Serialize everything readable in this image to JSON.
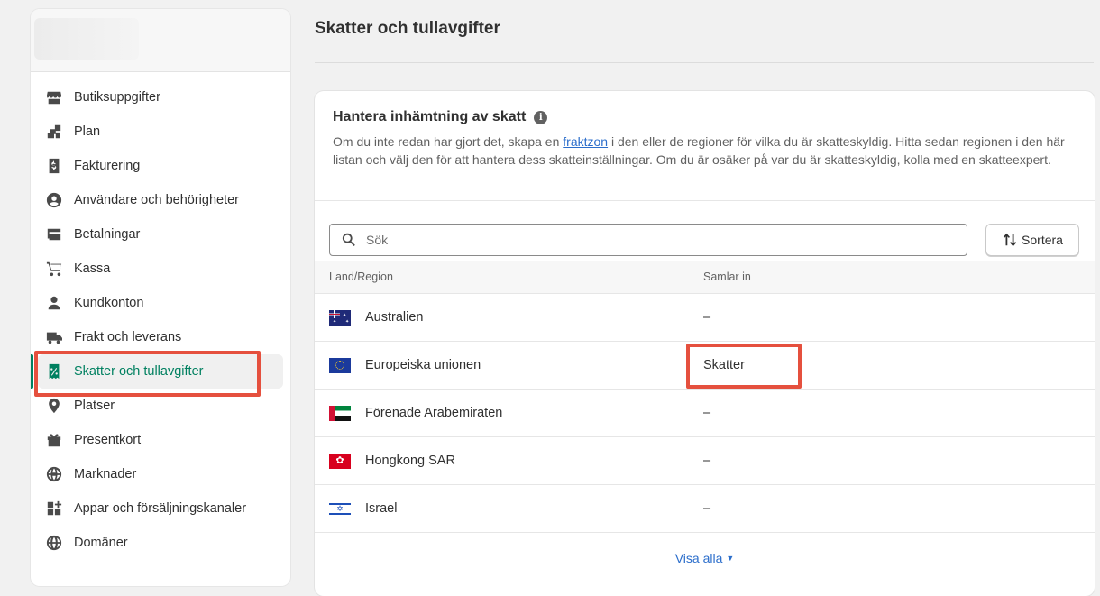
{
  "sidebar": {
    "items": [
      {
        "label": "Butiksuppgifter",
        "icon": "store-icon"
      },
      {
        "label": "Plan",
        "icon": "plan-icon"
      },
      {
        "label": "Fakturering",
        "icon": "billing-icon"
      },
      {
        "label": "Användare och behörigheter",
        "icon": "user-circle-icon"
      },
      {
        "label": "Betalningar",
        "icon": "payments-icon"
      },
      {
        "label": "Kassa",
        "icon": "cart-icon"
      },
      {
        "label": "Kundkonton",
        "icon": "person-icon"
      },
      {
        "label": "Frakt och leverans",
        "icon": "truck-icon"
      },
      {
        "label": "Skatter och tullavgifter",
        "icon": "tax-receipt-icon",
        "active": true
      },
      {
        "label": "Platser",
        "icon": "location-pin-icon"
      },
      {
        "label": "Presentkort",
        "icon": "gift-icon"
      },
      {
        "label": "Marknader",
        "icon": "globe-icon"
      },
      {
        "label": "Appar och försäljningskanaler",
        "icon": "apps-icon"
      },
      {
        "label": "Domäner",
        "icon": "domains-globe-icon"
      }
    ]
  },
  "page": {
    "title": "Skatter och tullavgifter"
  },
  "card": {
    "title": "Hantera inhämtning av skatt",
    "desc_before": "Om du inte redan har gjort det, skapa en ",
    "desc_link": "fraktzon",
    "desc_after": " i den eller de regioner för vilka du är skatteskyldig. Hitta sedan regionen i den här listan och välj den för att hantera dess skatteinställningar. Om du är osäker på var du är skatteskyldig, kolla med en skatteexpert.",
    "info_glyph": "i"
  },
  "search": {
    "placeholder": "Sök"
  },
  "sort": {
    "label": "Sortera"
  },
  "table": {
    "headers": {
      "country": "Land/Region",
      "collect": "Samlar in"
    },
    "rows": [
      {
        "country": "Australien",
        "flag": "flag-australia",
        "collect": "–"
      },
      {
        "country": "Europeiska unionen",
        "flag": "flag-eu",
        "collect": "Skatter"
      },
      {
        "country": "Förenade Arabemiraten",
        "flag": "flag-uae",
        "collect": "–"
      },
      {
        "country": "Hongkong SAR",
        "flag": "flag-hongkong",
        "collect": "–"
      },
      {
        "country": "Israel",
        "flag": "flag-israel",
        "collect": "–"
      }
    ]
  },
  "show_all": {
    "label": "Visa alla"
  },
  "colors": {
    "accent": "#008060",
    "link": "#2c6ecb",
    "annotation": "#e5503e"
  }
}
